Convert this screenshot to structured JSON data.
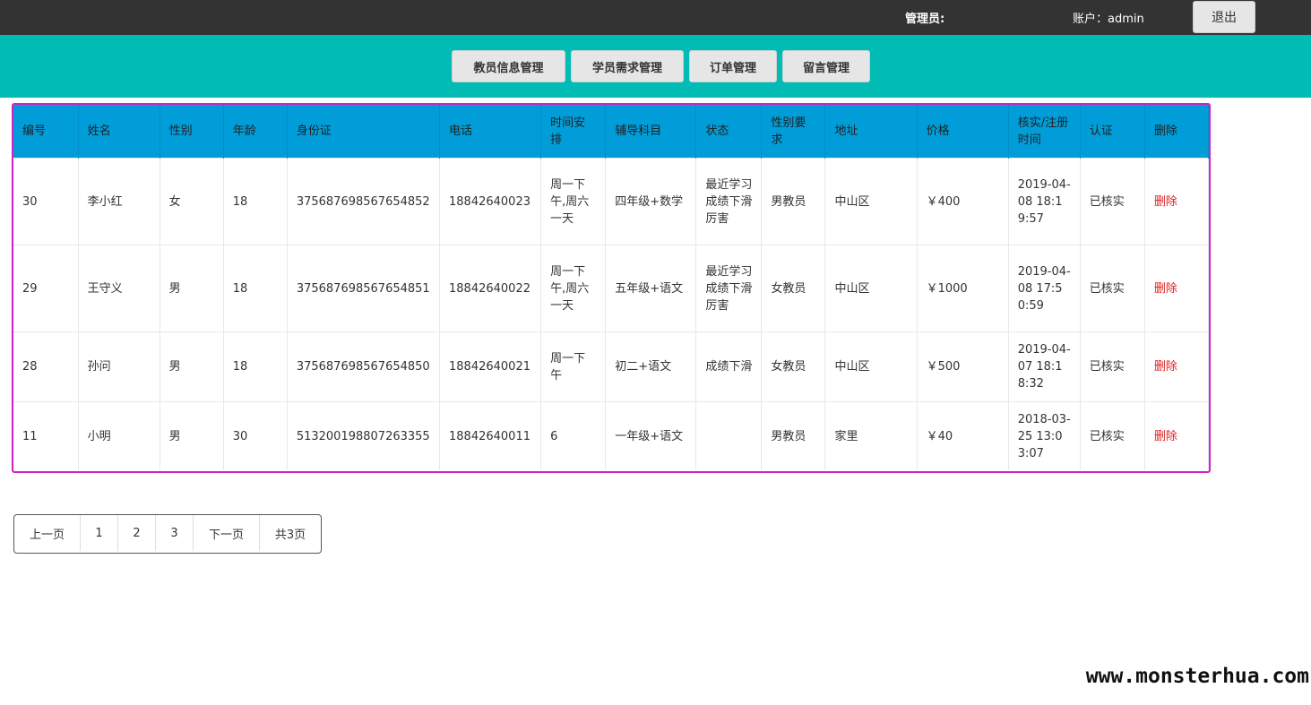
{
  "header": {
    "admin_label": "管理员:",
    "account_label": "账户：admin",
    "logout": "退出"
  },
  "nav": {
    "teacher_info": "教员信息管理",
    "student_needs": "学员需求管理",
    "orders": "订单管理",
    "messages": "留言管理"
  },
  "table": {
    "columns": [
      "编号",
      "姓名",
      "性别",
      "年龄",
      "身份证",
      "电话",
      "时间安排",
      "辅导科目",
      "状态",
      "性别要求",
      "地址",
      "价格",
      "核实/注册时间",
      "认证",
      "删除"
    ],
    "rows": [
      [
        "30",
        "李小红",
        "女",
        "18",
        "375687698567654852",
        "18842640023",
        "周一下午,周六一天",
        "四年级+数学",
        "最近学习成绩下滑厉害",
        "男教员",
        "中山区",
        "￥400",
        "2019-04-08 18:19:57",
        "已核实",
        "删除"
      ],
      [
        "29",
        "王守义",
        "男",
        "18",
        "375687698567654851",
        "18842640022",
        "周一下午,周六一天",
        "五年级+语文",
        "最近学习成绩下滑厉害",
        "女教员",
        "中山区",
        "￥1000",
        "2019-04-08 17:50:59",
        "已核实",
        "删除"
      ],
      [
        "28",
        "孙问",
        "男",
        "18",
        "375687698567654850",
        "18842640021",
        "周一下午",
        "初二+语文",
        "成绩下滑",
        "女教员",
        "中山区",
        "￥500",
        "2019-04-07 18:18:32",
        "已核实",
        "删除"
      ],
      [
        "11",
        "小明",
        "男",
        "30",
        "513200198807263355",
        "18842640011",
        "6",
        "一年级+语文",
        "",
        "男教员",
        "家里",
        "￥40",
        "2018-03-25 13:03:07",
        "已核实",
        "删除"
      ]
    ]
  },
  "pager": {
    "prev": "上一页",
    "pages": [
      "1",
      "2",
      "3"
    ],
    "next": "下一页",
    "total": "共3页"
  },
  "watermark": "www.monsterhua.com",
  "colors": {
    "topbar": "#333333",
    "navbar": "#00bcb5",
    "table_header": "#009dd9",
    "table_border": "#d020c8",
    "delete_text": "#e02020"
  }
}
